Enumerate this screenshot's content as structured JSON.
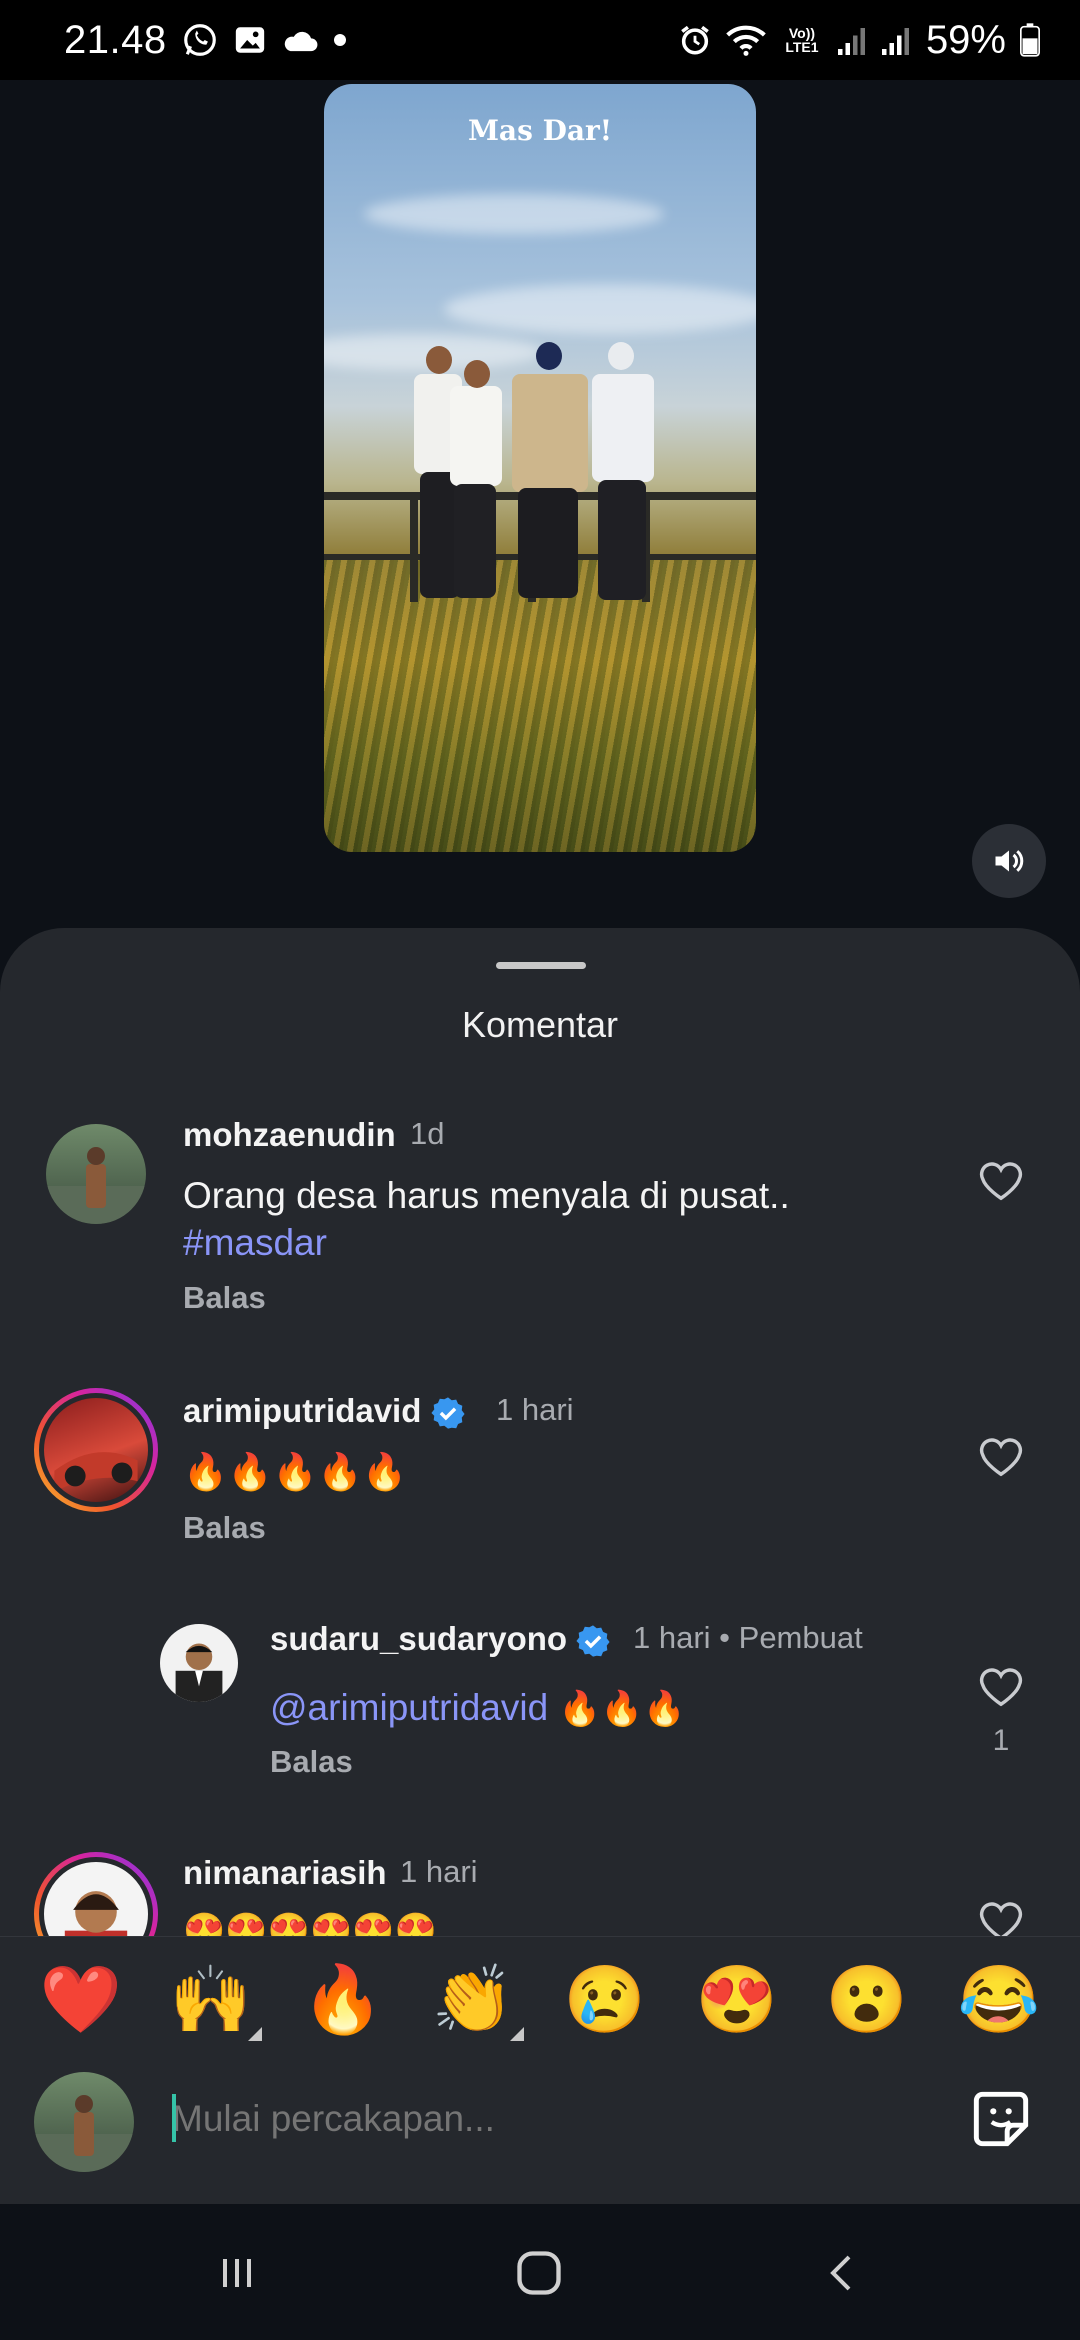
{
  "status_bar": {
    "time": "21.48",
    "battery": "59%",
    "icons": [
      "whatsapp-icon",
      "gallery-icon",
      "cloud-icon",
      "dot-icon",
      "alarm-icon",
      "wifi-icon",
      "volte-icon",
      "signal-icon",
      "signal-icon",
      "battery-icon"
    ],
    "network_label": "Vo)) LTE1"
  },
  "video": {
    "watermark": "Mas Dar!",
    "sound_icon": "speaker-icon"
  },
  "comments_sheet": {
    "title": "Komentar",
    "comments": [
      {
        "username": "mohzaenudin",
        "time": "1d",
        "text": "Orang desa harus menyala di pusat..",
        "hashtag": "#masdar",
        "reply_label": "Balas",
        "verified": false
      },
      {
        "username": "arimiputridavid",
        "time": "1 hari",
        "text": "🔥🔥🔥🔥🔥",
        "reply_label": "Balas",
        "verified": true
      },
      {
        "username": "sudaru_sudaryono",
        "time": "1 hari",
        "creator_label": "Pembuat",
        "mention": "@arimiputridavid",
        "text": "🔥🔥🔥",
        "reply_label": "Balas",
        "likes": "1",
        "verified": true
      },
      {
        "username": "nimanariasih",
        "time": "1 hari",
        "text": "😍😍😍😍😍😍",
        "verified": false
      }
    ]
  },
  "emoji_bar": [
    "❤️",
    "🙌",
    "🔥",
    "👏",
    "😢",
    "😍",
    "😮",
    "😂"
  ],
  "composer": {
    "placeholder": "Mulai percakapan...",
    "sticker_icon": "sticker-icon"
  },
  "nav_bar": {
    "buttons": [
      "recent-apps-icon",
      "home-icon",
      "back-icon"
    ]
  },
  "colors": {
    "sheet_bg": "#25282d",
    "hashtag": "#8a95f7",
    "verified": "#3897f0"
  }
}
